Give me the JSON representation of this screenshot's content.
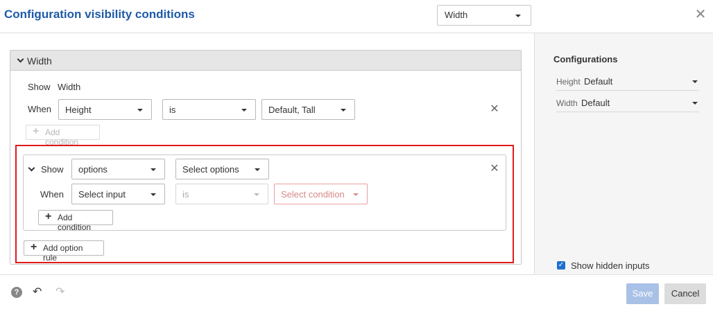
{
  "header": {
    "title": "Configuration visibility conditions",
    "input_select_value": "Width",
    "close_icon": "close-icon"
  },
  "section": {
    "title": "Width",
    "show_label": "Show",
    "show_value": "Width",
    "when_label": "When",
    "condition": {
      "input": "Height",
      "operator": "is",
      "values": "Default, Tall"
    },
    "add_condition_label": "Add condition"
  },
  "option_rule": {
    "show_label": "Show",
    "type_value": "options",
    "options_select": "Select options",
    "when_label": "When",
    "input_select": "Select input",
    "operator": "is",
    "condition_select": "Select condition",
    "add_condition_label": "Add condition",
    "add_option_rule_label": "Add option rule"
  },
  "configurations": {
    "title": "Configurations",
    "rows": [
      {
        "label": "Height",
        "value": "Default"
      },
      {
        "label": "Width",
        "value": "Default"
      }
    ],
    "show_hidden_label": "Show hidden inputs",
    "show_hidden_checked": true
  },
  "footer": {
    "save_label": "Save",
    "cancel_label": "Cancel"
  },
  "colors": {
    "title_blue": "#1f5aa8",
    "highlight_red": "#e0181b",
    "save_disabled": "#a9c1e6",
    "checkbox_blue": "#1f6fd0"
  }
}
